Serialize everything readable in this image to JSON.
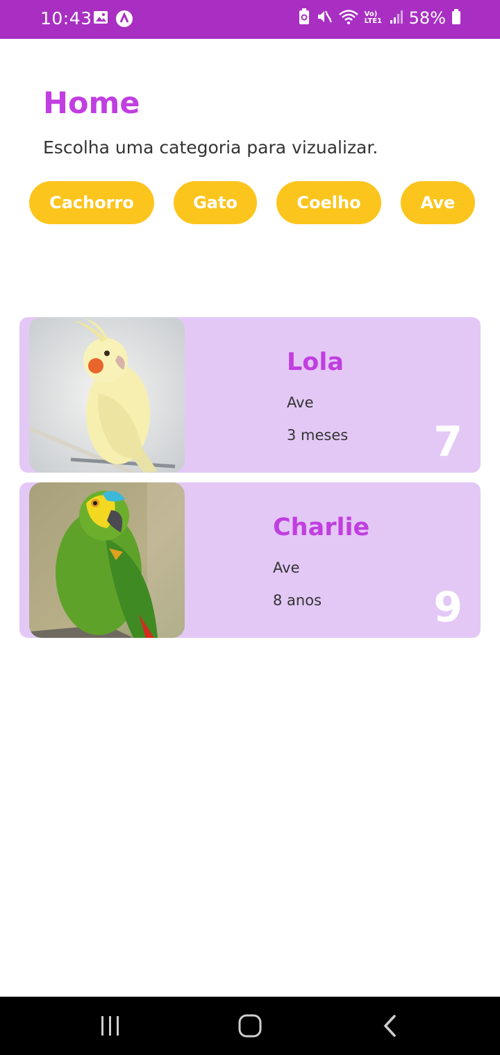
{
  "status_bar": {
    "time": "10:43",
    "battery_percent": "58%",
    "signal_label": "Vo) LTE1",
    "icons_left": [
      "image-icon",
      "app-notification-icon"
    ],
    "icons_right": [
      "battery-saver-icon",
      "mute-icon",
      "wifi-icon",
      "signal-icon",
      "battery-icon"
    ],
    "background": "#a82fc2"
  },
  "header": {
    "title": "Home",
    "subtitle": "Escolha uma categoria para vizualizar."
  },
  "categories": [
    {
      "label": "Cachorro"
    },
    {
      "label": "Gato"
    },
    {
      "label": "Coelho"
    },
    {
      "label": "Ave"
    }
  ],
  "pets": [
    {
      "name": "Lola",
      "category": "Ave",
      "age": "3 meses",
      "number": "7",
      "photo": "cockatiel-photo"
    },
    {
      "name": "Charlie",
      "category": "Ave",
      "age": "8 anos",
      "number": "9",
      "photo": "parrot-photo"
    }
  ],
  "nav_bar": {
    "buttons": [
      "recent-apps-icon",
      "home-icon",
      "back-icon"
    ]
  },
  "colors": {
    "accent": "#c13ee0",
    "chip": "#fcc51d",
    "card": "#e3c8f6",
    "status_bar": "#a82fc2"
  }
}
